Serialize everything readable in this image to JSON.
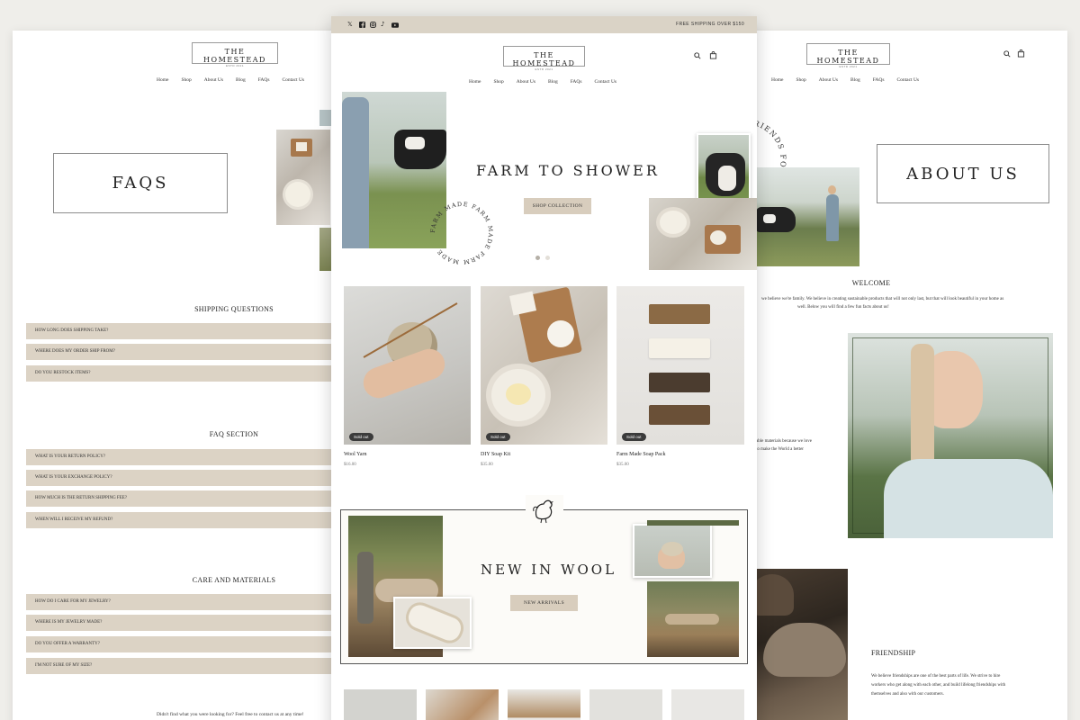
{
  "brand": {
    "name": "THE HOMESTEAD",
    "est": "ESTD 2021"
  },
  "nav": [
    "Home",
    "Shop",
    "About Us",
    "Blog",
    "FAQs",
    "Contact Us"
  ],
  "faq_page": {
    "title": "FAQS",
    "sections": [
      {
        "heading": "SHIPPING QUESTIONS",
        "items": [
          "HOW LONG DOES SHIPPING TAKE?",
          "WHERE DOES MY ORDER SHIP FROM?",
          "DO YOU RESTOCK ITEMS?"
        ]
      },
      {
        "heading": "FAQ SECTION",
        "items": [
          "WHAT IS YOUR RETURN POLICY?",
          "WHAT IS YOUR EXCHANGE POLICY?",
          "HOW MUCH IS THE RETURN SHIPPING FEE?",
          "WHEN WILL I RECEIVE MY REFUND?"
        ]
      },
      {
        "heading": "CARE AND MATERIALS",
        "items": [
          "HOW DO I CARE FOR MY JEWELRY?",
          "WHERE IS MY JEWELRY MADE?",
          "DO YOU OFFER A WARRANTY?",
          "I'M NOT SURE OF MY SIZE?"
        ]
      }
    ],
    "footer_note": "Didn't find what you were looking for? Feel free to contact us at any time!"
  },
  "home_page": {
    "announcement": "FREE SHIPPING OVER $150",
    "social_icons": [
      "twitter-icon",
      "facebook-icon",
      "instagram-icon",
      "tiktok-icon",
      "youtube-icon"
    ],
    "hero": {
      "title": "FARM TO SHOWER",
      "button": "SHOP COLLECTION",
      "circle_text": "FARM MADE FARM MADE FARM MADE",
      "slides": 2,
      "active_slide": 1
    },
    "products": [
      {
        "name": "Wool Yarn",
        "price": "$16.00",
        "badge": "Sold out"
      },
      {
        "name": "DIY Soap Kit",
        "price": "$35.00",
        "badge": "Sold out"
      },
      {
        "name": "Farm Made Soap Pack",
        "price": "$35.00",
        "badge": "Sold out"
      }
    ],
    "promo": {
      "title": "NEW IN WOOL",
      "button": "NEW ARRIVALS"
    }
  },
  "about_page": {
    "title": "ABOUT US",
    "circle_text": "FRIENDS FOREVER",
    "welcome_heading": "WELCOME",
    "welcome_text_1": "we believe we're family. We believe in creating sustainable products that will not only last, but that will look beautiful in your home as",
    "welcome_text_2": "well. Below you will find a few fun facts about us!",
    "materials_text_1": "able materials because we love",
    "materials_text_2": "to make the World a better",
    "friendship_heading": "FRIENDSHIP",
    "friendship_text_1": "We believe friendships are one of the best parts of life. We strive to hire",
    "friendship_text_2": "workers who get along with each other, and build lifelong friendships with",
    "friendship_text_3": "themselves and also with our customers."
  },
  "colors": {
    "background": "#efeeea",
    "accent_beige": "#dcd3c5",
    "button_beige": "#d8cdbd",
    "topbar": "#dad3c6",
    "badge": "#3b3b3b"
  }
}
